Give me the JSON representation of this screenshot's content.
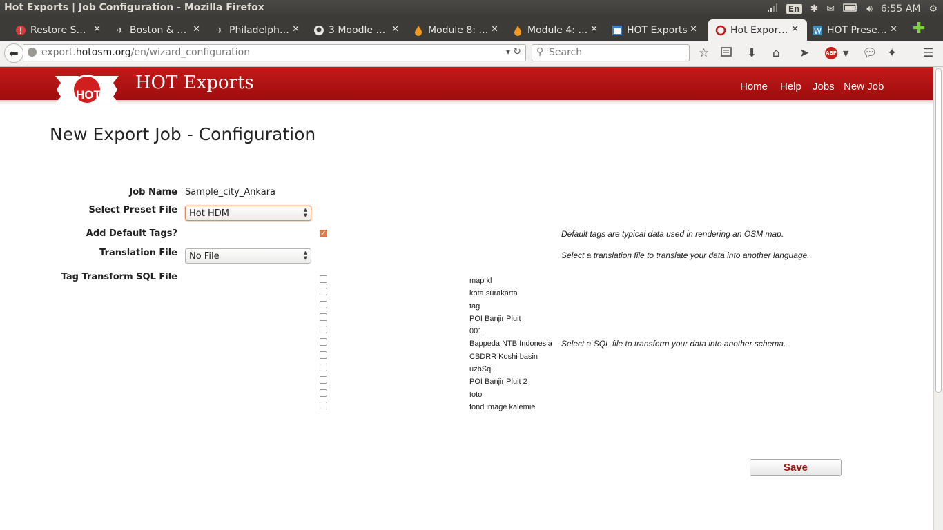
{
  "os": {
    "window_title": "Hot Exports | Job Configuration - Mozilla Firefox",
    "keyboard_lang": "En",
    "clock": "6:55 AM"
  },
  "tabs": [
    {
      "label": "Restore S…",
      "icon": "warning-icon"
    },
    {
      "label": "Boston & …",
      "icon": "bird-icon"
    },
    {
      "label": "Philadelph…",
      "icon": "bird-icon"
    },
    {
      "label": "3 Moodle …",
      "icon": "github-icon"
    },
    {
      "label": "Module 8: …",
      "icon": "flame-icon"
    },
    {
      "label": "Module 4: …",
      "icon": "flame-icon"
    },
    {
      "label": "HOT Exports",
      "icon": "app-icon"
    },
    {
      "label": "Hot Expor…",
      "icon": "hot-logo-icon",
      "active": true
    },
    {
      "label": "HOT Prese…",
      "icon": "wordpress-icon"
    }
  ],
  "navbar": {
    "url_host_prefix": "export.",
    "url_host_main": "hotosm.org",
    "url_path": "/en/wizard_configuration",
    "search_placeholder": "Search"
  },
  "site": {
    "brand": "HOT Exports",
    "logo_text": "HOT",
    "menu": [
      "Home",
      "Help",
      "Jobs",
      "New Job"
    ]
  },
  "page": {
    "title": "New Export Job - Configuration"
  },
  "form": {
    "job_name_label": "Job Name",
    "job_name_value": "Sample_city_Ankara",
    "preset_label": "Select Preset File",
    "preset_value": "Hot HDM",
    "default_tags_label": "Add Default Tags?",
    "default_tags_checked": true,
    "default_tags_hint": "Default tags are typical data used in rendering an OSM map.",
    "translation_label": "Translation File",
    "translation_value": "No File",
    "translation_hint": "Select a translation file to translate your data into another language.",
    "sql_label": "Tag Transform SQL File",
    "sql_hint": "Select a SQL file to transform your data into another schema.",
    "sql_files": [
      "map kl",
      "kota surakarta",
      "tag",
      "POI Banjir Pluit",
      "001",
      "Bappeda NTB Indonesia",
      "CBDRR Koshi basin",
      "uzbSql",
      "POI Banjir Pluit 2",
      "toto",
      "fond image kalemie"
    ],
    "save_label": "Save"
  },
  "colors": {
    "header_red": "#b31212",
    "checkbox_accent": "#e07a4a",
    "save_text": "#9e1212"
  }
}
